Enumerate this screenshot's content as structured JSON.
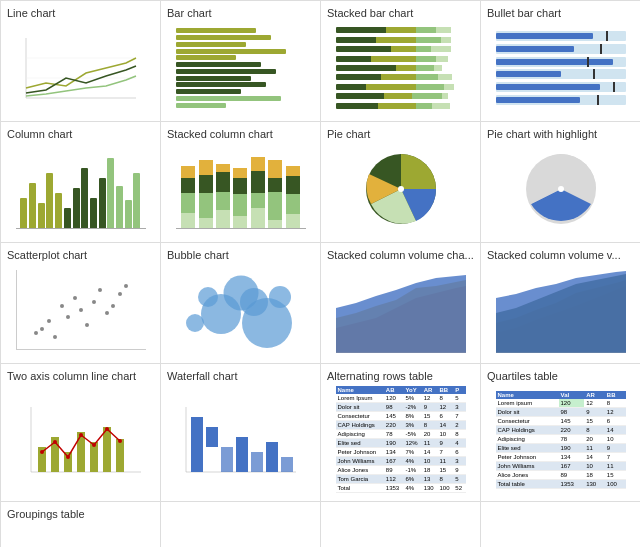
{
  "charts": [
    {
      "id": "line-chart",
      "label": "Line chart"
    },
    {
      "id": "bar-chart",
      "label": "Bar chart"
    },
    {
      "id": "stacked-bar-chart",
      "label": "Stacked bar chart"
    },
    {
      "id": "bullet-bar-chart",
      "label": "Bullet bar chart"
    },
    {
      "id": "column-chart",
      "label": "Column chart"
    },
    {
      "id": "stacked-column-chart",
      "label": "Stacked column chart"
    },
    {
      "id": "pie-chart",
      "label": "Pie chart"
    },
    {
      "id": "pie-highlight-chart",
      "label": "Pie chart with highlight"
    },
    {
      "id": "scatterplot-chart",
      "label": "Scatterplot chart"
    },
    {
      "id": "bubble-chart",
      "label": "Bubble chart"
    },
    {
      "id": "stacked-col-vol-chart",
      "label": "Stacked column volume cha..."
    },
    {
      "id": "stacked-col-vol2-chart",
      "label": "Stacked column volume v..."
    },
    {
      "id": "two-axis-chart",
      "label": "Two axis column line chart"
    },
    {
      "id": "waterfall-chart",
      "label": "Waterfall chart"
    },
    {
      "id": "alternating-table",
      "label": "Alternating rows table"
    },
    {
      "id": "quartiles-table",
      "label": "Quartiles table"
    },
    {
      "id": "groupings-table",
      "label": "Groupings table"
    },
    {
      "id": "empty1",
      "label": ""
    },
    {
      "id": "empty2",
      "label": ""
    },
    {
      "id": "empty3",
      "label": ""
    }
  ]
}
